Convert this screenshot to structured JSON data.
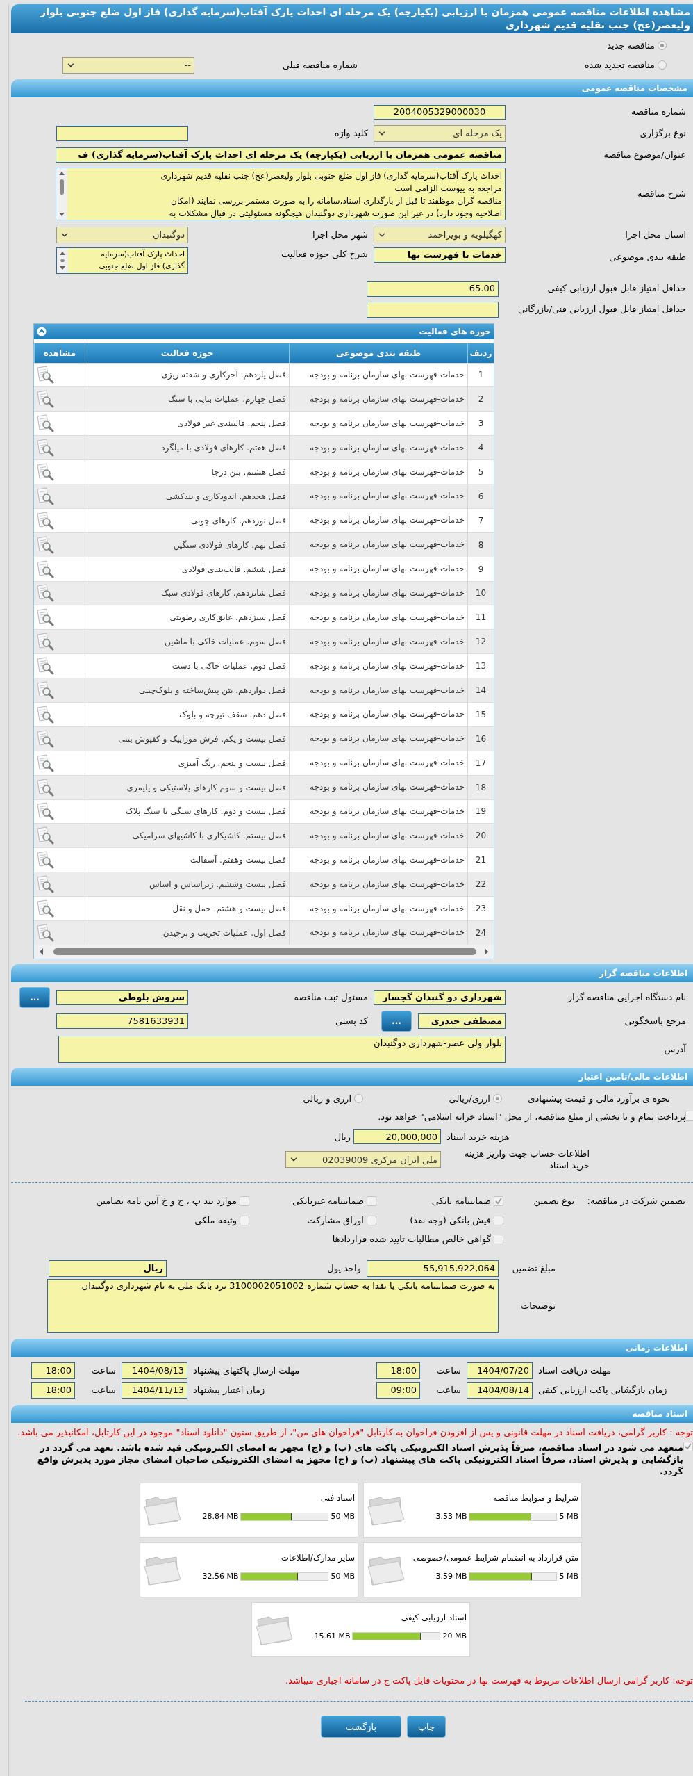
{
  "page_title": "مشاهده اطلاعات مناقصه عمومی همزمان با ارزیابی (یکپارچه) یک مرحله ای احداث پارک آفتاب(سرمایه گذاری) فاز اول ضلع جنوبی بلوار ولیعصر(عج) جنب نقلیه قدیم شهرداری",
  "tender_status": [
    {
      "label": "مناقصه جدید",
      "selected": true
    },
    {
      "label": "مناقصه تجدید شده",
      "selected": false
    }
  ],
  "previous_tender": {
    "label": "شماره مناقصه قبلی",
    "value": "--"
  },
  "general": {
    "title": "مشخصات مناقصه عمومی",
    "tender_number": {
      "label": "شماره مناقصه",
      "value": "2004005329000030"
    },
    "holding_type": {
      "label": "نوع برگزاری",
      "value": "یک مرحله ای"
    },
    "keyword": {
      "label": "کلید واژه"
    },
    "subject": {
      "label": "عنوان/موضوع مناقصه",
      "value": "مناقصه عمومی همزمان با ارزیابی (یکپارچه) یک مرحله ای احداث پارک آفتاب(سرمایه گذاری) ف"
    },
    "description": {
      "label": "شرح مناقصه",
      "lines": [
        "احداث پارک آفتاب(سرمایه گذاری) فاز اول ضلع جنوبی بلوار ولیعصر(عج) جنب نقلیه قدیم شهرداری",
        "مراجعه به پیوست الزامی است",
        "مناقصه گران موظفند تا قبل از بارگذاری اسناد،سامانه را به صورت مستمر بررسی نمایند (امکان",
        "اصلاحیه وجود دارد) در غیر این صورت شهرداری دوگنبدان هیچگونه مسئولیتی در قبال مشکلات به"
      ]
    },
    "province": {
      "label": "استان محل اجرا",
      "value": "کهگیلویه و بویراحمد"
    },
    "city": {
      "label": "شهر محل اجرا",
      "value": "دوگنبدان"
    },
    "classification": {
      "label": "طبقه بندی موضوعی",
      "value": "خدمات با فهرست بها"
    },
    "activity_summary": {
      "label": "شرح کلی حوزه فعالیت",
      "lines": [
        "احداث پارک آفتاب(سرمایه",
        "گذاری) فاز اول ضلع جنوبی"
      ]
    },
    "min_quality_score": {
      "label": "حداقل امتیاز قابل قبول ارزیابی کیفی",
      "value": "65.00"
    },
    "min_technical_score": {
      "label": "حداقل امتیاز قابل قبول ارزیابی فنی/بازرگانی"
    }
  },
  "activities": {
    "title": "حوزه های فعالیت",
    "columns": [
      "ردیف",
      "طبقه بندی موضوعی",
      "حوزه فعالیت",
      "مشاهده"
    ],
    "rows": [
      {
        "number": "1",
        "classification": "خدمات-فهرست بهای سازمان برنامه و بودجه",
        "activity": "فصل یازدهم. آجرکاری و شفته ریزی"
      },
      {
        "number": "2",
        "classification": "خدمات-فهرست بهای سازمان برنامه و بودجه",
        "activity": "فصل چهارم. عملیات بنایی با سنگ"
      },
      {
        "number": "3",
        "classification": "خدمات-فهرست بهای سازمان برنامه و بودجه",
        "activity": "فصل پنجم. قالببندی غیر فولادی"
      },
      {
        "number": "4",
        "classification": "خدمات-فهرست بهای سازمان برنامه و بودجه",
        "activity": "فصل هفتم. کارهای فولادی با میلگرد"
      },
      {
        "number": "5",
        "classification": "خدمات-فهرست بهای سازمان برنامه و بودجه",
        "activity": "فصل هشتم. بتن درجا"
      },
      {
        "number": "6",
        "classification": "خدمات-فهرست بهای سازمان برنامه و بودجه",
        "activity": "فصل هجدهم. اندودکاری و بندکشی"
      },
      {
        "number": "7",
        "classification": "خدمات-فهرست بهای سازمان برنامه و بودجه",
        "activity": "فصل نوزدهم. کارهای چوبی"
      },
      {
        "number": "8",
        "classification": "خدمات-فهرست بهای سازمان برنامه و بودجه",
        "activity": "فصل نهم. کارهای فولادی سنگین"
      },
      {
        "number": "9",
        "classification": "خدمات-فهرست بهای سازمان برنامه و بودجه",
        "activity": "فصل ششم. قالب‌بندی فولادی"
      },
      {
        "number": "10",
        "classification": "خدمات-فهرست بهای سازمان برنامه و بودجه",
        "activity": "فصل شانزدهم. کارهای فولادی سبک"
      },
      {
        "number": "11",
        "classification": "خدمات-فهرست بهای سازمان برنامه و بودجه",
        "activity": "فصل سیزدهم. عایق‌کاری رطوبتی"
      },
      {
        "number": "12",
        "classification": "خدمات-فهرست بهای سازمان برنامه و بودجه",
        "activity": "فصل سوم. عملیات خاکی با ماشین"
      },
      {
        "number": "13",
        "classification": "خدمات-فهرست بهای سازمان برنامه و بودجه",
        "activity": "فصل دوم. عملیات خاکی با دست"
      },
      {
        "number": "14",
        "classification": "خدمات-فهرست بهای سازمان برنامه و بودجه",
        "activity": "فصل دوازدهم. بتن پیش‌ساخته و بلوک‌چینی"
      },
      {
        "number": "15",
        "classification": "خدمات-فهرست بهای سازمان برنامه و بودجه",
        "activity": "فصل دهم. سقف تیرچه و بلوک"
      },
      {
        "number": "16",
        "classification": "خدمات-فهرست بهای سازمان برنامه و بودجه",
        "activity": "فصل بیست و یکم. فرش موزاییک و کفپوش بتنی"
      },
      {
        "number": "17",
        "classification": "خدمات-فهرست بهای سازمان برنامه و بودجه",
        "activity": "فصل بیست و پنجم. رنگ آمیزی"
      },
      {
        "number": "18",
        "classification": "خدمات-فهرست بهای سازمان برنامه و بودجه",
        "activity": "فصل بیست و سوم کارهای پلاستیکی و پلیمری"
      },
      {
        "number": "19",
        "classification": "خدمات-فهرست بهای سازمان برنامه و بودجه",
        "activity": "فصل بیست و دوم. کارهای سنگی با سنگ پلاک"
      },
      {
        "number": "20",
        "classification": "خدمات-فهرست بهای سازمان برنامه و بودجه",
        "activity": "فصل بیستم. کاشیکاری با کاشیهای سرامیکی"
      },
      {
        "number": "21",
        "classification": "خدمات-فهرست بهای سازمان برنامه و بودجه",
        "activity": "فصل بیست وهفتم. آسفالت"
      },
      {
        "number": "22",
        "classification": "خدمات-فهرست بهای سازمان برنامه و بودجه",
        "activity": "فصل بیست وششم. زیراساس و اساس"
      },
      {
        "number": "23",
        "classification": "خدمات-فهرست بهای سازمان برنامه و بودجه",
        "activity": "فصل بیست و هشتم. حمل و نقل"
      },
      {
        "number": "24",
        "classification": "خدمات-فهرست بهای سازمان برنامه و بودجه",
        "activity": "فصل اول. عملیات تخریب و برچیدن"
      }
    ]
  },
  "organizer": {
    "title": "اطلاعات مناقصه گزار",
    "agency": {
      "label": "نام دستگاه اجرایی مناقصه گزار",
      "value": "شهرداری دو گنبدان گچسار"
    },
    "registrar": {
      "label": "مسئول ثبت مناقصه",
      "value": "سروش بلوطی",
      "button": "..."
    },
    "contact": {
      "label": "مرجع پاسخگویی",
      "value": "مصطفی حیدری",
      "button": "..."
    },
    "postal_code": {
      "label": "کد پستی",
      "value": "7581633931"
    },
    "address": {
      "label": "آدرس",
      "value": "بلوار ولی عصر-شهرداری دوگنبدان"
    }
  },
  "finance": {
    "title": "اطلاعات مالی/تامین اعتبار",
    "estimate_method": {
      "label": "نحوه ی برآورد مالی و قیمت پیشنهادی",
      "options": [
        {
          "label": "ارزی/ریالی",
          "selected": true
        },
        {
          "label": "ارزی و ریالی",
          "selected": false
        }
      ]
    },
    "treasury": {
      "label": "پرداخت تمام و یا بخشی از مبلغ مناقصه، از محل \"اسناد خزانه اسلامی\" خواهد بود.",
      "checked": false
    },
    "document_fee": {
      "label": "هزینه خرید اسناد",
      "value": "20,000,000",
      "unit": "ریال"
    },
    "account": {
      "label": "اطلاعات حساب جهت واریز هزینه خرید اسناد",
      "value": "ملی ایران مرکزی 02039009"
    },
    "guarantee": {
      "label": "تضمین شرکت در مناقصه:",
      "type_label": "نوع تضمین",
      "options": [
        {
          "label": "ضمانتنامه بانکی",
          "checked": true
        },
        {
          "label": "ضمانتنامه غیربانکی",
          "checked": false
        },
        {
          "label": "موارد بند پ ، ح و خ آیین نامه تضامین",
          "checked": false
        },
        {
          "label": "فیش بانکی (وجه نقد)",
          "checked": false
        },
        {
          "label": "اوراق مشارکت",
          "checked": false
        },
        {
          "label": "وثیقه ملکی",
          "checked": false
        },
        {
          "label": "گواهی خالص مطالبات تایید شده قراردادها",
          "checked": false
        }
      ]
    },
    "amount": {
      "label": "مبلغ تضمین",
      "value": "55,915,922,064"
    },
    "currency": {
      "label": "واحد پول",
      "value": "ریال"
    },
    "notes": {
      "label": "توضیحات",
      "value": "به صورت ضمانتنامه بانکی یا نقدا به حساب شماره 3100002051002 نزد بانک ملی به نام شهرداری دوگنبدان"
    }
  },
  "schedule": {
    "title": "اطلاعات زمانی",
    "rows": [
      [
        {
          "label": "مهلت دریافت اسناد",
          "date": "1404/07/20",
          "time_label": "ساعت",
          "time": "18:00"
        },
        {
          "label": "مهلت ارسال پاکتهای پیشنهاد",
          "date": "1404/08/13",
          "time_label": "ساعت",
          "time": "18:00"
        }
      ],
      [
        {
          "label": "زمان بازگشایی پاکت ارزیابی کیفی",
          "date": "1404/08/14",
          "time_label": "ساعت",
          "time": "09:00"
        },
        {
          "label": "زمان اعتبار پیشنهاد",
          "date": "1404/11/13",
          "time_label": "ساعت",
          "time": "18:00"
        }
      ]
    ]
  },
  "documents": {
    "title": "اسناد مناقصه",
    "notice": "توجه : کاربر گرامی، دریافت اسناد در مهلت قانونی و پس از افزودن فراخوان به کارتابل \"فراخوان های من\"، از طریق ستون \"دانلود اسناد\" موجود در این کارتابل، امکانپذیر می باشد.",
    "commitment": {
      "label": "متعهد می شود در اسناد مناقصه، صرفاً پذیرش اسناد الکترونیکی پاکت های (ب) و (ج) مجهز به امضای الکترونیکی قید شده باشد. تعهد می گردد در بازگشایی و پذیرش اسناد، صرفاً اسناد الکترونیکی پاکت های پیشنهاد (ب) و (ج) مجهز به امضای الکترونیکی صاحبان امضای مجاز مورد پذیرش واقع گردد.",
      "checked": true
    },
    "files": [
      {
        "title": "شرایط و ضوابط مناقصه",
        "used": "3.53 MB",
        "max": "5 MB",
        "level": 0.706
      },
      {
        "title": "اسناد فنی",
        "used": "28.84 MB",
        "max": "50 MB",
        "level": 0.577
      },
      {
        "title": "متن قرارداد به انضمام شرایط عمومی/خصوصی",
        "used": "3.59 MB",
        "max": "5 MB",
        "level": 0.718
      },
      {
        "title": "سایر مدارک/اطلاعات",
        "used": "32.56 MB",
        "max": "50 MB",
        "level": 0.651
      },
      {
        "title": "اسناد ارزیابی کیفی",
        "used": "15.61 MB",
        "max": "20 MB",
        "level": 0.78
      }
    ],
    "notice2": "توجه: کاربر گرامی ارسال اطلاعات مربوط به فهرست بها در محتویات فایل پاکت ج در سامانه اجباری میباشد."
  },
  "buttons": [
    "چاپ",
    "بازگشت"
  ]
}
